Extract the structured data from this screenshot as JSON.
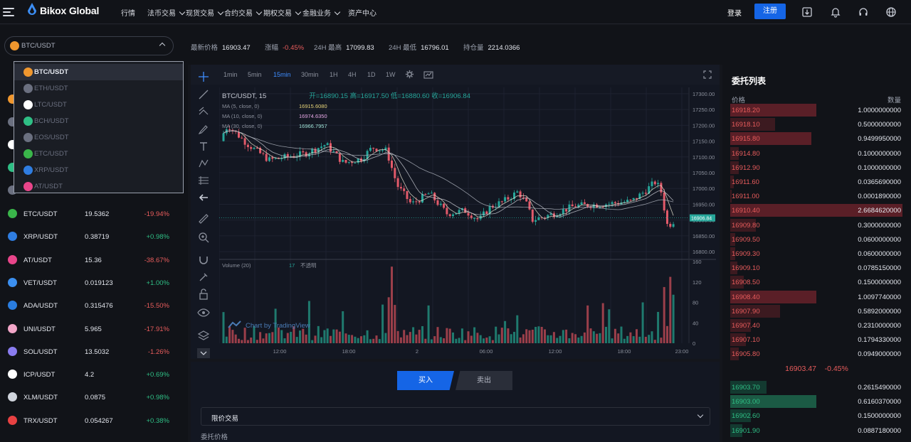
{
  "nav": {
    "logo": "Bikox Global",
    "menu": [
      {
        "label": "行情",
        "caret": false
      },
      {
        "label": "法币交易",
        "caret": true
      },
      {
        "label": "现货交易",
        "caret": true
      },
      {
        "label": "合约交易",
        "caret": true
      },
      {
        "label": "期权交易",
        "caret": true
      },
      {
        "label": "金融业务",
        "caret": true
      },
      {
        "label": "资产中心",
        "caret": false
      }
    ],
    "login": "登录",
    "register": "注册",
    "icons": [
      "download-icon",
      "bell-icon",
      "headset-icon",
      "globe-icon"
    ]
  },
  "ticker": {
    "pair": "BTC/USDT",
    "stats": [
      {
        "label": "最新价格",
        "value": "16903.47",
        "color": "normal"
      },
      {
        "label": "涨幅",
        "value": "-0.45%",
        "color": "red"
      },
      {
        "label": "24H 最高",
        "value": "17099.83",
        "color": "normal"
      },
      {
        "label": "24H 最低",
        "value": "16796.01",
        "color": "normal"
      },
      {
        "label": "持仓量",
        "value": "2214.0366",
        "color": "normal"
      }
    ]
  },
  "dropdown": {
    "options": [
      {
        "label": "BTC/USDT",
        "icon": "bitcoin-icon",
        "color": "#f0972e",
        "selected": true
      },
      {
        "label": "ETH/USDT",
        "icon": "ethereum-icon",
        "color": "#6b7080",
        "selected": false
      },
      {
        "label": "LTC/USDT",
        "icon": "litecoin-icon",
        "color": "#ffffff",
        "selected": false
      },
      {
        "label": "BCH/USDT",
        "icon": "bitcoin-cash-icon",
        "color": "#2fbf85",
        "selected": false
      },
      {
        "label": "EOS/USDT",
        "icon": "eos-icon",
        "color": "#6b7080",
        "selected": false
      },
      {
        "label": "ETC/USDT",
        "icon": "ethereum-classic-icon",
        "color": "#3ab54a",
        "selected": false
      },
      {
        "label": "XRP/USDT",
        "icon": "xrp-icon",
        "color": "#2f7de1",
        "selected": false
      },
      {
        "label": "AT/USDT",
        "icon": "at-icon",
        "color": "#e8458a",
        "selected": false
      }
    ]
  },
  "markets": [
    {
      "sym": "ETC/USDT",
      "price": "19.5362",
      "change": "-19.94%",
      "dir": "down",
      "icon": "ethereum-classic-icon",
      "color": "#3ab54a"
    },
    {
      "sym": "XRP/USDT",
      "price": "0.38719",
      "change": "+0.98%",
      "dir": "up",
      "icon": "xrp-icon",
      "color": "#2f7de1"
    },
    {
      "sym": "AT/USDT",
      "price": "15.36",
      "change": "-38.67%",
      "dir": "down",
      "icon": "at-icon",
      "color": "#e8458a"
    },
    {
      "sym": "VET/USDT",
      "price": "0.019123",
      "change": "+1.00%",
      "dir": "up",
      "icon": "vechain-icon",
      "color": "#3b8ff0"
    },
    {
      "sym": "ADA/USDT",
      "price": "0.315476",
      "change": "-15.50%",
      "dir": "down",
      "icon": "cardano-icon",
      "color": "#2a7de0"
    },
    {
      "sym": "UNI/USDT",
      "price": "5.965",
      "change": "-17.91%",
      "dir": "down",
      "icon": "uniswap-icon",
      "color": "#f2a6c8"
    },
    {
      "sym": "SOL/USDT",
      "price": "13.5032",
      "change": "-1.26%",
      "dir": "down",
      "icon": "solana-icon",
      "color": "#8a7cf0"
    },
    {
      "sym": "ICP/USDT",
      "price": "4.2",
      "change": "+0.69%",
      "dir": "up",
      "icon": "icp-icon",
      "color": "#ffffff"
    },
    {
      "sym": "XLM/USDT",
      "price": "0.0875",
      "change": "+0.98%",
      "dir": "up",
      "icon": "stellar-icon",
      "color": "#d0d4dc"
    },
    {
      "sym": "TRX/USDT",
      "price": "0.054267",
      "change": "+0.38%",
      "dir": "up",
      "icon": "tron-icon",
      "color": "#e84142"
    }
  ],
  "chart": {
    "timeframes": [
      "1min",
      "5min",
      "15min",
      "30min",
      "1H",
      "4H",
      "1D",
      "1W"
    ],
    "active_timeframe": "15min",
    "legend_symbol": "BTC/USDT, 15",
    "ohlc": "开=16890.15 高=16917.50 低=16880.60 收=16906.84",
    "ma_lines": [
      {
        "label": "MA (5, close, 0)",
        "value": "16915.6080",
        "color": "#e9d67a"
      },
      {
        "label": "MA (10, close, 0)",
        "value": "16974.6350",
        "color": "#e7a8e6"
      },
      {
        "label": "MA (30, close, 0)",
        "value": "16966.7957",
        "color": "#9de0d5"
      }
    ],
    "volume_label": "Volume (20)",
    "volume_value": "17",
    "volume_status": "不透明",
    "watermark": "Chart by TradingView",
    "last_price_tag": "16906.84",
    "price_axis": [
      "17300.00",
      "17250.00",
      "17200.00",
      "17150.00",
      "17100.00",
      "17050.00",
      "17000.00",
      "16950.00",
      "16900.00",
      "16850.00",
      "16800.00"
    ],
    "volume_axis": [
      "160",
      "120",
      "80",
      "40",
      "0"
    ],
    "time_axis": [
      "12:00",
      "18:00",
      "2",
      "06:00",
      "12:00",
      "18:00",
      "23:00"
    ]
  },
  "chart_data": {
    "type": "line",
    "title": "BTC/USDT, 15",
    "xlabel": "",
    "ylabel": "",
    "ylim": [
      16780,
      17320
    ],
    "x": [
      "12:00",
      "18:00",
      "2",
      "06:00",
      "12:00",
      "18:00",
      "23:00"
    ],
    "series": [
      {
        "name": "MA (5, close, 0)",
        "values": [
          17160,
          17120,
          17110,
          16970,
          16950,
          16960,
          16915
        ]
      },
      {
        "name": "MA (10, close, 0)",
        "values": [
          17150,
          17125,
          17115,
          16985,
          16955,
          16965,
          16975
        ]
      },
      {
        "name": "MA (30, close, 0)",
        "values": [
          17100,
          17120,
          17110,
          17020,
          16975,
          16960,
          16967
        ]
      }
    ]
  },
  "trade": {
    "buy": "买入",
    "sell": "卖出",
    "order_type": "限价交易",
    "price_label": "委托价格"
  },
  "orderbook": {
    "title": "委托列表",
    "col_price": "价格",
    "col_qty": "数量",
    "asks": [
      {
        "price": "16918.20",
        "qty": "1.0000000000",
        "depth": 0.5
      },
      {
        "price": "16918.10",
        "qty": "0.5000000000",
        "depth": 0.26
      },
      {
        "price": "16915.80",
        "qty": "0.9499950000",
        "depth": 0.47
      },
      {
        "price": "16914.80",
        "qty": "0.1000000000",
        "depth": 0.05
      },
      {
        "price": "16912.90",
        "qty": "0.1000000000",
        "depth": 0.05
      },
      {
        "price": "16911.60",
        "qty": "0.0365690000",
        "depth": 0.02
      },
      {
        "price": "16911.00",
        "qty": "0.0001890000",
        "depth": 0.0
      },
      {
        "price": "16910.40",
        "qty": "2.6684620000",
        "depth": 1.0
      },
      {
        "price": "16909.80",
        "qty": "0.3000000000",
        "depth": 0.15
      },
      {
        "price": "16909.50",
        "qty": "0.0600000000",
        "depth": 0.03
      },
      {
        "price": "16909.30",
        "qty": "0.0600000000",
        "depth": 0.03
      },
      {
        "price": "16909.10",
        "qty": "0.0785150000",
        "depth": 0.04
      },
      {
        "price": "16908.50",
        "qty": "0.1500000000",
        "depth": 0.08
      },
      {
        "price": "16908.40",
        "qty": "1.0097740000",
        "depth": 0.5
      },
      {
        "price": "16907.90",
        "qty": "0.5892000000",
        "depth": 0.29
      },
      {
        "price": "16907.40",
        "qty": "0.2310000000",
        "depth": 0.12
      },
      {
        "price": "16907.10",
        "qty": "0.1794330000",
        "depth": 0.09
      },
      {
        "price": "16905.80",
        "qty": "0.0949000000",
        "depth": 0.05
      }
    ],
    "mid_price": "16903.47",
    "mid_change": "-0.45%",
    "bids": [
      {
        "price": "16903.70",
        "qty": "0.2615490000",
        "depth": 0.21
      },
      {
        "price": "16903.00",
        "qty": "0.6160370000",
        "depth": 0.5
      },
      {
        "price": "16902.60",
        "qty": "0.1500000000",
        "depth": 0.12
      },
      {
        "price": "16901.90",
        "qty": "0.0887180000",
        "depth": 0.07
      }
    ]
  },
  "colors": {
    "accent": "#1565e6",
    "up": "#2fbf85",
    "down": "#e85c5c"
  }
}
